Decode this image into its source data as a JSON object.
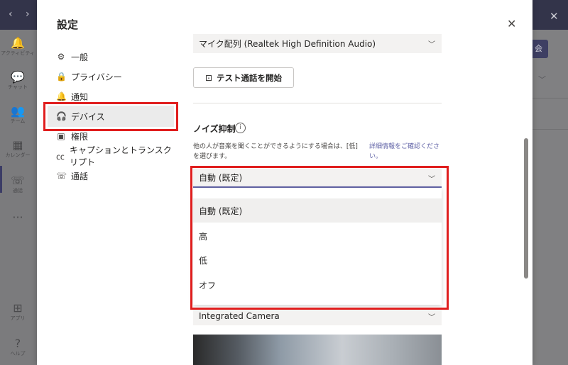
{
  "background_app": {
    "rail": [
      {
        "icon": "bell-icon",
        "glyph": "🔔",
        "label": "アクティビティ"
      },
      {
        "icon": "chat-icon",
        "glyph": "💬",
        "label": "チャット"
      },
      {
        "icon": "teams-icon",
        "glyph": "👥",
        "label": "チーム"
      },
      {
        "icon": "calendar-icon",
        "glyph": "▦",
        "label": "カレンダー"
      },
      {
        "icon": "phone-icon",
        "glyph": "☏",
        "label": "通話"
      },
      {
        "icon": "more-icon",
        "glyph": "···",
        "label": ""
      },
      {
        "icon": "apps-icon",
        "glyph": "⊞",
        "label": "アプリ"
      },
      {
        "icon": "help-icon",
        "glyph": "?",
        "label": "ヘルプ"
      }
    ]
  },
  "settings": {
    "title": "設定",
    "nav": [
      {
        "glyph": "⚙",
        "label": "一般"
      },
      {
        "glyph": "🔒",
        "label": "プライバシー"
      },
      {
        "glyph": "🔔",
        "label": "通知"
      },
      {
        "glyph": "🎧",
        "label": "デバイス"
      },
      {
        "glyph": "▣",
        "label": "権限"
      },
      {
        "glyph": "㏄",
        "label": "キャプションとトランスクリプト"
      },
      {
        "glyph": "☏",
        "label": "通話"
      }
    ],
    "selected_nav": "デバイス",
    "microphone": {
      "value": "マイク配列 (Realtek High Definition Audio)"
    },
    "test_call_button": "テスト通話を開始",
    "noise": {
      "title": "ノイズ抑制",
      "description": "他の人が音楽を聞くことができるようにする場合は、[低] を選びます。",
      "link": "詳細情報をご確認ください。",
      "selected": "自動 (既定)",
      "options": [
        "自動 (既定)",
        "高",
        "低",
        "オフ"
      ]
    },
    "camera": {
      "value": "Integrated Camera"
    }
  }
}
